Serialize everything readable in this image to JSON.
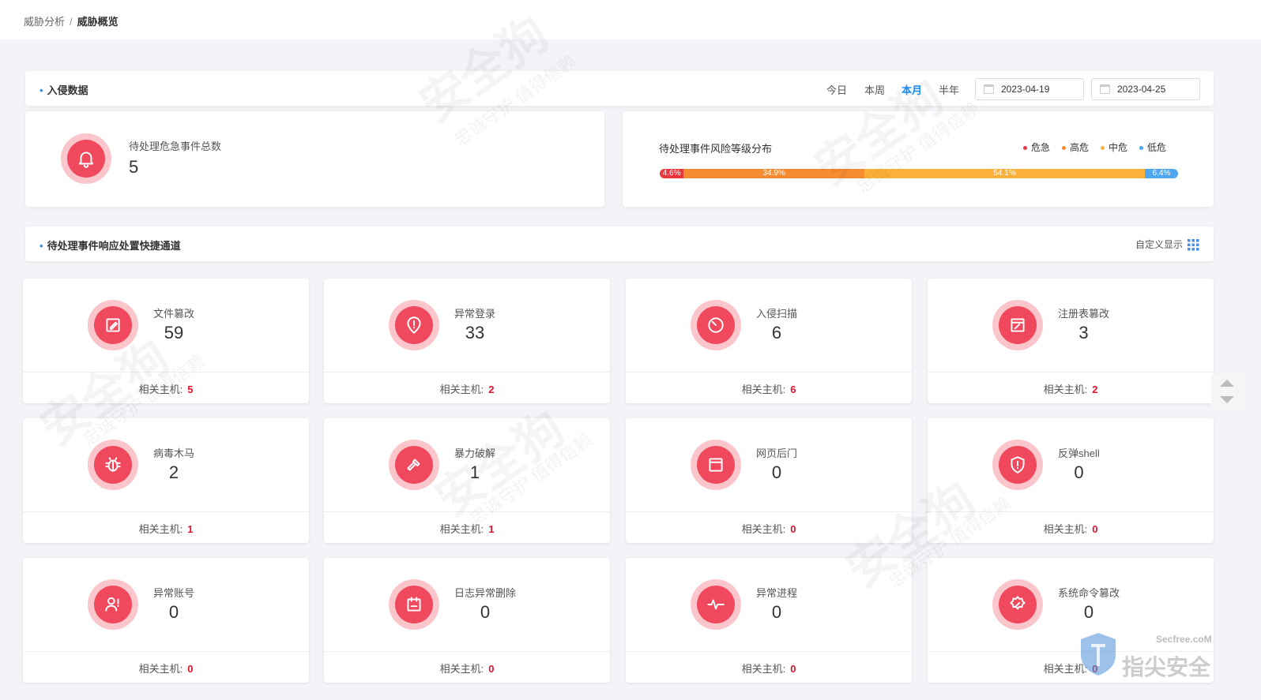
{
  "breadcrumb": {
    "parent": "威胁分析",
    "separator": "/",
    "current": "威胁概览"
  },
  "intrusion": {
    "title": "入侵数据",
    "filters": [
      "今日",
      "本周",
      "本月",
      "半年"
    ],
    "active_filter": "本月",
    "date_start": "2023-04-19",
    "date_end": "2023-04-25"
  },
  "summary": {
    "label": "待处理危急事件总数",
    "value": "5"
  },
  "risk": {
    "title": "待处理事件风险等级分布",
    "legend": [
      "危急",
      "高危",
      "中危",
      "低危"
    ],
    "colors": [
      "#e8383d",
      "#f68c32",
      "#fbb03b",
      "#4ea7f0"
    ],
    "segments": [
      {
        "level": "危急",
        "percent": 4.6,
        "label": "4.6%"
      },
      {
        "level": "高危",
        "percent": 34.9,
        "label": "34.9%"
      },
      {
        "level": "中危",
        "percent": 54.1,
        "label": "54.1%"
      },
      {
        "level": "低危",
        "percent": 6.4,
        "label": "6.4%"
      }
    ]
  },
  "channel": {
    "title": "待处理事件响应处置快捷通道",
    "custom_label": "自定义显示"
  },
  "host_label": "相关主机:",
  "cards": [
    {
      "name": "文件篡改",
      "count": "59",
      "hosts": "5",
      "icon": "file-edit-icon"
    },
    {
      "name": "异常登录",
      "count": "33",
      "hosts": "2",
      "icon": "location-alert-icon"
    },
    {
      "name": "入侵扫描",
      "count": "6",
      "hosts": "6",
      "icon": "scan-icon"
    },
    {
      "name": "注册表篡改",
      "count": "3",
      "hosts": "2",
      "icon": "registry-edit-icon"
    },
    {
      "name": "病毒木马",
      "count": "2",
      "hosts": "1",
      "icon": "bug-icon"
    },
    {
      "name": "暴力破解",
      "count": "1",
      "hosts": "1",
      "icon": "hammer-icon"
    },
    {
      "name": "网页后门",
      "count": "0",
      "hosts": "0",
      "icon": "webpage-icon"
    },
    {
      "name": "反弹shell",
      "count": "0",
      "hosts": "0",
      "icon": "shield-alert-icon"
    },
    {
      "name": "异常账号",
      "count": "0",
      "hosts": "0",
      "icon": "user-alert-icon"
    },
    {
      "name": "日志异常删除",
      "count": "0",
      "hosts": "0",
      "icon": "log-delete-icon"
    },
    {
      "name": "异常进程",
      "count": "0",
      "hosts": "0",
      "icon": "pulse-icon"
    },
    {
      "name": "系统命令篡改",
      "count": "0",
      "hosts": "0",
      "icon": "gear-edit-icon"
    }
  ],
  "watermark": {
    "main": "安全狗",
    "sub": "忠诚守护 值得信赖",
    "site": "Secfree.coM",
    "brand": "指尖安全"
  }
}
